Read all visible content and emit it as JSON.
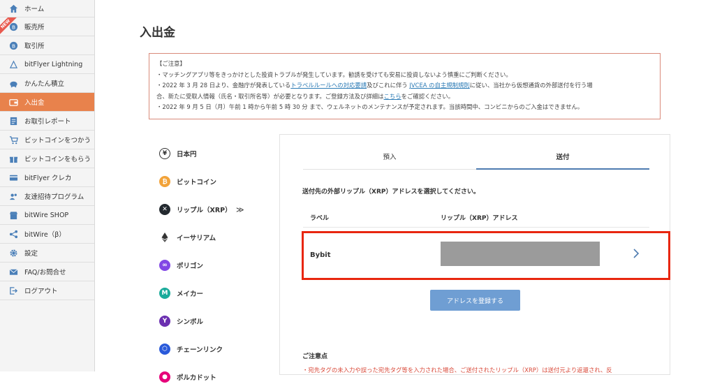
{
  "sidebar": {
    "new_badge": "NEW",
    "items": [
      {
        "label": "ホーム",
        "icon": "home-icon"
      },
      {
        "label": "販売所",
        "icon": "bitcoin-coin-icon"
      },
      {
        "label": "取引所",
        "icon": "bitcoin-coin-icon"
      },
      {
        "label": "bitFlyer Lightning",
        "icon": "lightning-triangle-icon"
      },
      {
        "label": "かんたん積立",
        "icon": "piggy-bank-icon"
      },
      {
        "label": "入出金",
        "icon": "wallet-icon",
        "active": true
      },
      {
        "label": "お取引レポート",
        "icon": "report-icon"
      },
      {
        "label": "ビットコインをつかう",
        "icon": "cart-icon"
      },
      {
        "label": "ビットコインをもらう",
        "icon": "gift-icon"
      },
      {
        "label": "bitFlyer クレカ",
        "icon": "credit-card-icon"
      },
      {
        "label": "友達招待プログラム",
        "icon": "invite-friends-icon"
      },
      {
        "label": "bitWire SHOP",
        "icon": "shop-icon"
      },
      {
        "label": "bitWire（β）",
        "icon": "share-icon"
      },
      {
        "label": "設定",
        "icon": "gear-icon"
      },
      {
        "label": "FAQ/お問合せ",
        "icon": "mail-icon"
      },
      {
        "label": "ログアウト",
        "icon": "logout-icon"
      }
    ]
  },
  "page_title": "入出金",
  "notice": {
    "heading": "【ご注意】",
    "line1": "・マッチングアプリ等をきっかけとした投資トラブルが発生しています。勧誘を受けても安易に投資しないよう慎重にご判断ください。",
    "line2_a": "・2022 年 3 月 28 日より、金融庁が発表している",
    "line2_link1": "トラベルルールへの対応要請",
    "line2_b": "及びこれに伴う ",
    "line2_link2": "JVCEA の自主規制規則",
    "line2_c": "に従い、当社から仮想通貨の外部送付を行う場",
    "line3_a": "合、新たに受取人情報（氏名・取引所名等）が必要となります。ご登録方法及び詳細は",
    "line3_link": "こちら",
    "line3_b": "をご確認ください。",
    "line4": "・2022 年 9 月 5 日（月）午前 1 時から午前 5 時 30 分 まで、ウェルネットのメンテナンスが予定されます。当該時間中、コンビニからのご入金はできません。"
  },
  "currencies": [
    {
      "label": "日本円",
      "icon": "yen-icon",
      "color": "#ffffff"
    },
    {
      "label": "ビットコイン",
      "icon": "bitcoin-icon",
      "color": "#f2a33a"
    },
    {
      "label": "リップル（XRP）",
      "icon": "xrp-icon",
      "color": "#23292f",
      "selected_marker": "≫"
    },
    {
      "label": "イーサリアム",
      "icon": "ethereum-icon",
      "color": "#ffffff"
    },
    {
      "label": "ポリゴン",
      "icon": "polygon-icon",
      "color": "#8247e5"
    },
    {
      "label": "メイカー",
      "icon": "maker-icon",
      "color": "#1aab9b"
    },
    {
      "label": "シンボル",
      "icon": "symbol-icon",
      "color": "#6b2fb0"
    },
    {
      "label": "チェーンリンク",
      "icon": "chainlink-icon",
      "color": "#2a5ada"
    },
    {
      "label": "ポルカドット",
      "icon": "polkadot-icon",
      "color": "#e6007a"
    }
  ],
  "panel": {
    "tab_deposit": "預入",
    "tab_send": "送付",
    "select_prompt": "送付先の外部リップル（XRP）アドレスを選択してください。",
    "col_label": "ラベル",
    "col_address": "リップル（XRP）アドレス",
    "address_row": {
      "label": "Bybit"
    },
    "register_button": "アドレスを登録する",
    "caution_title": "ご注意点",
    "caution_text": "・宛先タグの未入力や誤った宛先タグ等を入力された場合、ご送付されたリップル（XRP）は送付元より返還され、反"
  },
  "colors": {
    "accent_active": "#e8824c",
    "link": "#2a7ab5",
    "button": "#6f9ed3",
    "highlight": "#e8260f",
    "notice_border": "#d98a7a"
  }
}
